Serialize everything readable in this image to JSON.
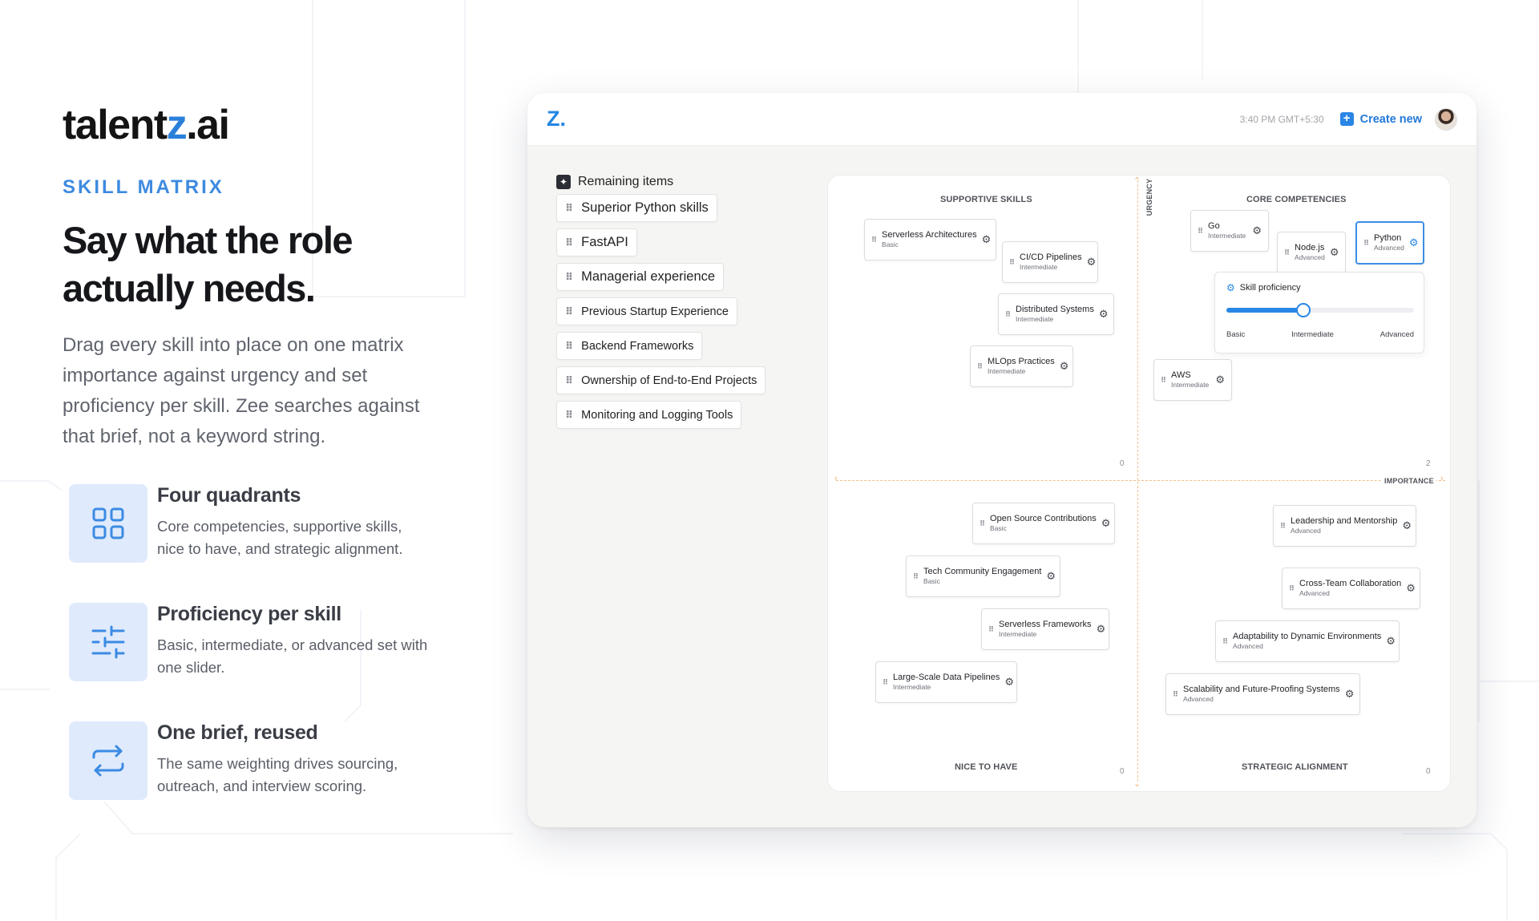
{
  "brand": {
    "logo_main": "talent",
    "logo_accent": "z",
    "logo_suffix": ".ai",
    "accent_color": "#2a7fd9"
  },
  "hero": {
    "eyebrow": "SKILL MATRIX",
    "headline": "Say what the role actually needs.",
    "lead": "Drag every skill into place on one matrix importance against urgency and set proficiency per skill. Zee searches against that brief, not a keyword string."
  },
  "features": [
    {
      "icon": "grid-icon",
      "title": "Four quadrants",
      "desc": "Core competencies, supportive skills, nice to have, and strategic alignment."
    },
    {
      "icon": "sliders-icon",
      "title": "Proficiency per skill",
      "desc": "Basic, intermediate, or advanced set with one slider."
    },
    {
      "icon": "repeat-icon",
      "title": "One brief, reused",
      "desc": "The same weighting drives sourcing, outreach, and interview scoring."
    }
  ],
  "app": {
    "logo": "Z",
    "logo_dot": ".",
    "time": "3:40 PM GMT+5:30",
    "create_label": "Create new",
    "create_plus": "+"
  },
  "remaining": {
    "title": "Remaining items",
    "items": [
      "Superior Python skills",
      "FastAPI",
      "Managerial experience",
      "Previous Startup Experience",
      "Backend Frameworks",
      "Ownership of End-to-End Projects",
      "Monitoring and Logging Tools"
    ]
  },
  "matrix": {
    "quadrants": {
      "supportive": {
        "title": "SUPPORTIVE SKILLS",
        "count": "0"
      },
      "core": {
        "title": "CORE COMPETENCIES",
        "count": "2"
      },
      "nice": {
        "title": "NICE TO HAVE",
        "count": "0"
      },
      "strategic": {
        "title": "STRATEGIC ALIGNMENT",
        "count": "0"
      }
    },
    "axis_urgency": "URGENCY",
    "axis_importance": "IMPORTANCE",
    "cards": [
      {
        "name": "Serverless Architectures",
        "level": "Basic"
      },
      {
        "name": "CI/CD Pipelines",
        "level": "Intermediate"
      },
      {
        "name": "Distributed Systems",
        "level": "Intermediate"
      },
      {
        "name": "MLOps Practices",
        "level": "Intermediate"
      },
      {
        "name": "Go",
        "level": "Intermediate"
      },
      {
        "name": "Node.js",
        "level": "Advanced"
      },
      {
        "name": "Python",
        "level": "Advanced"
      },
      {
        "name": "AWS",
        "level": "Intermediate"
      },
      {
        "name": "Open Source Contributions",
        "level": "Basic"
      },
      {
        "name": "Tech Community Engagement",
        "level": "Basic"
      },
      {
        "name": "Serverless Frameworks",
        "level": "Intermediate"
      },
      {
        "name": "Large-Scale Data Pipelines",
        "level": "Intermediate"
      },
      {
        "name": "Leadership and Mentorship",
        "level": "Advanced"
      },
      {
        "name": "Cross-Team Collaboration",
        "level": "Advanced"
      },
      {
        "name": "Adaptability to Dynamic Environments",
        "level": "Advanced"
      },
      {
        "name": "Scalability and Future-Proofing Systems",
        "level": "Advanced"
      }
    ],
    "proficiency": {
      "title": "Skill proficiency",
      "labels": [
        "Basic",
        "Intermediate",
        "Advanced"
      ],
      "value_fraction": 0.41
    }
  }
}
